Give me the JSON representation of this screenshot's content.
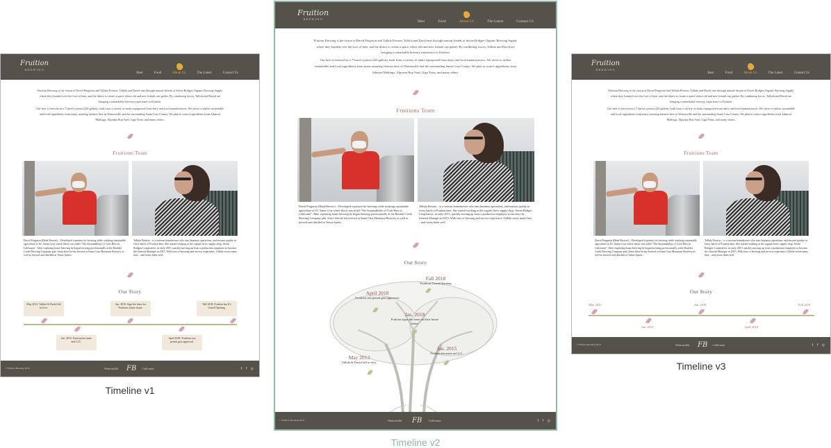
{
  "brand": {
    "logo": "Fruition",
    "logo_sub": "BREWING"
  },
  "nav": [
    "Beer",
    "Food",
    "About Us",
    "The Latest",
    "Contact Us"
  ],
  "nav_active": "About Us",
  "intro": [
    "Fruition Brewing is the vision of David Purgason and Tallula Preston. Tallula and David met through mutual friends at Seven Bridges Organic Brewing Supply where they bonded over the love of beer, and the desire to create a space where old and new friends can gather. By combining forces, Tallula and David are bringing a remarkable brewery experience to Fruition.",
    "Our beer is brewed on a 7 barrel system (220 gallon), built from a variety of tanks repurposed from dairy and food manufacturers. We strive to utilize sustainable and local ingredients from many amazing farmers here in Watsonville and the surrounding Santa Cruz County. We plan to source ingredients from Admiral Maltings, Alpyana Hop Yard, Giga Yeast, and many others."
  ],
  "team_title": "Fruitions Team",
  "bios": {
    "david": "David Purgason (Head Brewer) – Developed a passion for brewing while studying sustainable agriculture at UC Santa Cruz where thesis was titled “The Sustainability of Craft Beer in California”. After exploring home brewing he began brewing professionally at the Boulder Creek Brewing Company pub. Since then he has brewed at Santa Cruz Mountain Brewery as well as brewed and distilled at Venus Spirits.",
    "tallula": "Tallula Preston – is a veteran homebrewer who runs business operations, and ensures quality in every batch of Fruition beer. She started working at the organic brew supply shop, Seven Bridges Cooperative, in early 2013, quickly moving up from a production employee to become the General Manager in 2015. With tons of brewing and service experience, Tallula wears many hats – and wears them well."
  },
  "story_title": "Our Story",
  "v1_events": [
    {
      "text": "May 2013: Tallula & David fall in love."
    },
    {
      "text": "Jan. 2018: Sign the lease for Fruitions future home."
    },
    {
      "text": "Fall 2018: Fruition has It's Grand Opening."
    },
    {
      "text": "Jan. 2015: Fruition becomes and LLC."
    },
    {
      "text": "April 2018: Fruitions use permit gets approved."
    }
  ],
  "v2_events": [
    {
      "date": "Fall 2018",
      "text": "Fruitions Grand Opening"
    },
    {
      "date": "April 2018",
      "text": "Fruitions use permit gets approved."
    },
    {
      "date": "Jan. 2018",
      "text": "Fruition signs the lease on their future home."
    },
    {
      "date": "Jan. 2015",
      "text": "Fruition becomes an LLC."
    },
    {
      "date": "May 2013",
      "text": "Tallula & David fall in love."
    }
  ],
  "v3_dates": [
    "May 2013",
    "Jan. 2018",
    "Fall 2018",
    "Jan. 2015",
    "April 2018"
  ],
  "footer": {
    "copyright": "© Fruition Brewing 2018",
    "city_left": "Watsonville",
    "city_right": "California",
    "monogram": "FB",
    "social": [
      "twitter-icon",
      "facebook-icon",
      "instagram-icon"
    ],
    "social_glyphs": [
      "𝕥",
      "f",
      "◎"
    ]
  },
  "captions": {
    "v1": "Timeline v1",
    "v2": "Timeline v2",
    "v3": "Timeline v3"
  },
  "colors": {
    "header": "#55524b",
    "accent": "#e4a93a",
    "title": "#b27464",
    "card": "#f1e9dc",
    "selected_border": "#8fb9a3"
  }
}
